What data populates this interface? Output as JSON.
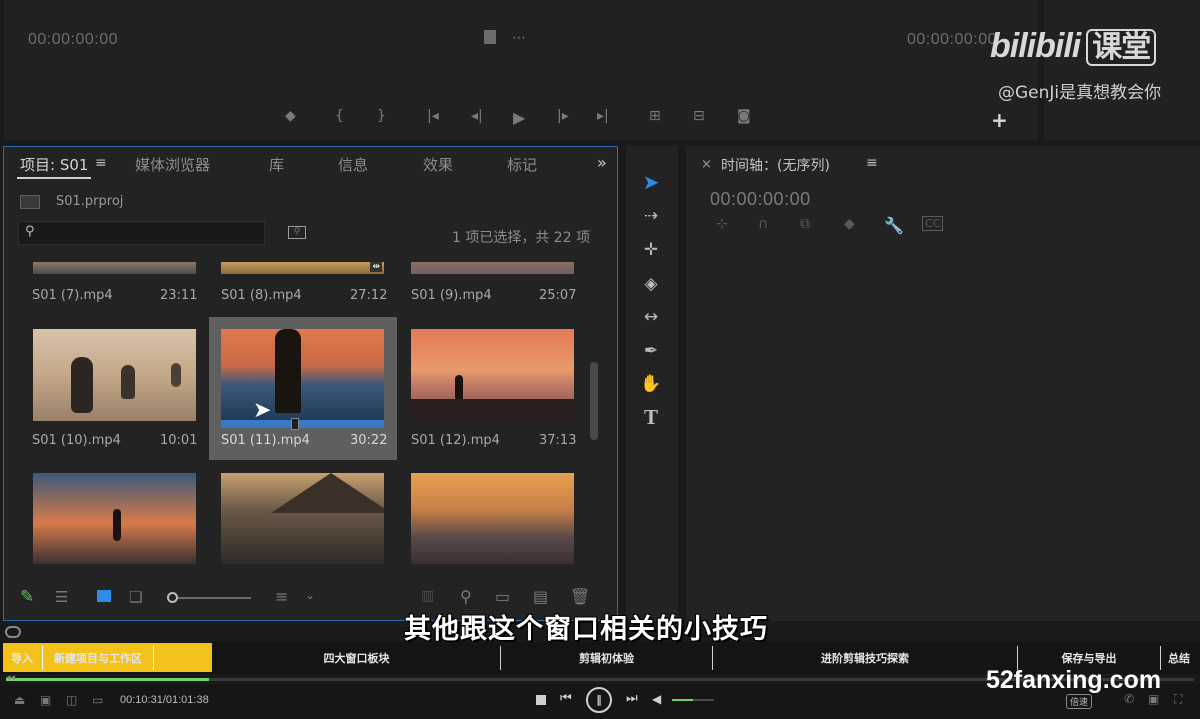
{
  "source_monitor": {
    "timecode_left": "00:00:00:00",
    "timecode_right": "00:00:00:00"
  },
  "watermark": {
    "logo": "bilibili",
    "logo_suffix": "课堂",
    "author": "@GenJi是真想教会你",
    "site": "52fanxing.com"
  },
  "project_panel": {
    "tabs": [
      "项目: S01",
      "媒体浏览器",
      "库",
      "信息",
      "效果",
      "标记"
    ],
    "file_name": "S01.prproj",
    "search_placeholder": "",
    "selection_info": "1 项已选择，共 22 项",
    "clips": [
      {
        "name": "S01 (7).mp4",
        "duration": "23:11"
      },
      {
        "name": "S01 (8).mp4",
        "duration": "27:12"
      },
      {
        "name": "S01 (9).mp4",
        "duration": "25:07"
      },
      {
        "name": "S01 (10).mp4",
        "duration": "10:01"
      },
      {
        "name": "S01 (11).mp4",
        "duration": "30:22"
      },
      {
        "name": "S01 (12).mp4",
        "duration": "37:13"
      }
    ]
  },
  "timeline_panel": {
    "title": "时间轴：(无序列)",
    "timecode": "00:00:00:00"
  },
  "subtitle": "其他跟这个窗口相关的小技巧",
  "chapters": [
    "导入",
    "新建项目与工作区",
    "四大窗口板块",
    "剪辑初体验",
    "进阶剪辑技巧探索",
    "保存与导出",
    "总结"
  ],
  "player": {
    "time": "00:10:31/01:01:38",
    "speed_label": "倍速",
    "progress": 0.171,
    "volume": 0.5
  },
  "colors": {
    "accent_blue": "#2d8ceb",
    "chapter_yellow": "#f2c21b",
    "progress_green": "#6fd26a"
  }
}
